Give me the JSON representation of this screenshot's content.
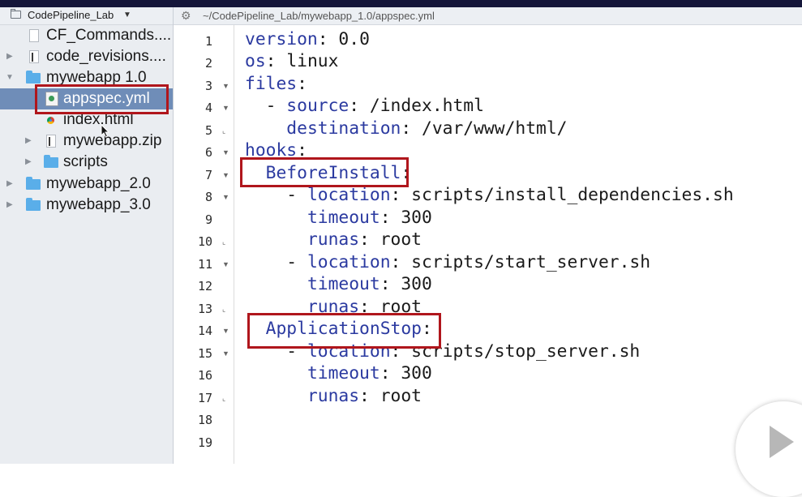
{
  "project": {
    "title": "CodePipeline_Lab",
    "dropdown_icon": "chevron-down-icon"
  },
  "sidebar": {
    "items": [
      {
        "label": "CF_Commands....",
        "icon": "file-icon",
        "arrow": ""
      },
      {
        "label": "code_revisions....",
        "icon": "file-icon",
        "arrow": "▶"
      },
      {
        "label": "mywebapp 1.0",
        "icon": "folder-icon",
        "arrow": "▼"
      },
      {
        "label": "appspec.yml",
        "icon": "yml-file-icon",
        "arrow": "",
        "selected": true
      },
      {
        "label": "index.html",
        "icon": "chrome-html-icon",
        "arrow": ""
      },
      {
        "label": "mywebapp.zip",
        "icon": "zip-file-icon",
        "arrow": "▶"
      },
      {
        "label": "scripts",
        "icon": "folder-icon",
        "arrow": "▶"
      },
      {
        "label": "mywebapp_2.0",
        "icon": "folder-icon",
        "arrow": "▶"
      },
      {
        "label": "mywebapp_3.0",
        "icon": "folder-icon",
        "arrow": "▶"
      }
    ]
  },
  "editor": {
    "path": "~/CodePipeline_Lab/mywebapp_1.0/appspec.yml",
    "line_numbers": [
      "1",
      "2",
      "3",
      "4",
      "5",
      "6",
      "7",
      "8",
      "9",
      "10",
      "11",
      "12",
      "13",
      "14",
      "15",
      "16",
      "17",
      "18",
      "19"
    ],
    "lines": [
      {
        "indent": "",
        "key": "version",
        "sep": ": ",
        "value": "0.0"
      },
      {
        "indent": "",
        "key": "os",
        "sep": ": ",
        "value": "linux"
      },
      {
        "indent": "",
        "key": "files",
        "sep": ":",
        "value": ""
      },
      {
        "indent": "  - ",
        "key": "source",
        "sep": ": ",
        "value": "/index.html"
      },
      {
        "indent": "    ",
        "key": "destination",
        "sep": ": ",
        "value": "/var/www/html/"
      },
      {
        "indent": "",
        "key": "hooks",
        "sep": ":",
        "value": ""
      },
      {
        "indent": "  ",
        "key": "BeforeInstall",
        "sep": ":",
        "value": ""
      },
      {
        "indent": "    - ",
        "key": "location",
        "sep": ": ",
        "value": "scripts/install_dependencies.sh"
      },
      {
        "indent": "      ",
        "key": "timeout",
        "sep": ": ",
        "value": "300"
      },
      {
        "indent": "      ",
        "key": "runas",
        "sep": ": ",
        "value": "root"
      },
      {
        "indent": "    - ",
        "key": "location",
        "sep": ": ",
        "value": "scripts/start_server.sh"
      },
      {
        "indent": "      ",
        "key": "timeout",
        "sep": ": ",
        "value": "300"
      },
      {
        "indent": "      ",
        "key": "runas",
        "sep": ": ",
        "value": "root"
      },
      {
        "indent": "  ",
        "key": "ApplicationStop",
        "sep": ":",
        "value": ""
      },
      {
        "indent": "    - ",
        "key": "location",
        "sep": ": ",
        "value": "scripts/stop_server.sh"
      },
      {
        "indent": "      ",
        "key": "timeout",
        "sep": ": ",
        "value": "300"
      },
      {
        "indent": "      ",
        "key": "runas",
        "sep": ": ",
        "value": "root"
      },
      {
        "indent": "",
        "key": "",
        "sep": "",
        "value": ""
      },
      {
        "indent": "",
        "key": "",
        "sep": "",
        "value": ""
      }
    ]
  },
  "colors": {
    "key": "#2b3aa0",
    "highlight": "#b0161c",
    "selection": "#6f8db8",
    "folder": "#5aaee9"
  }
}
